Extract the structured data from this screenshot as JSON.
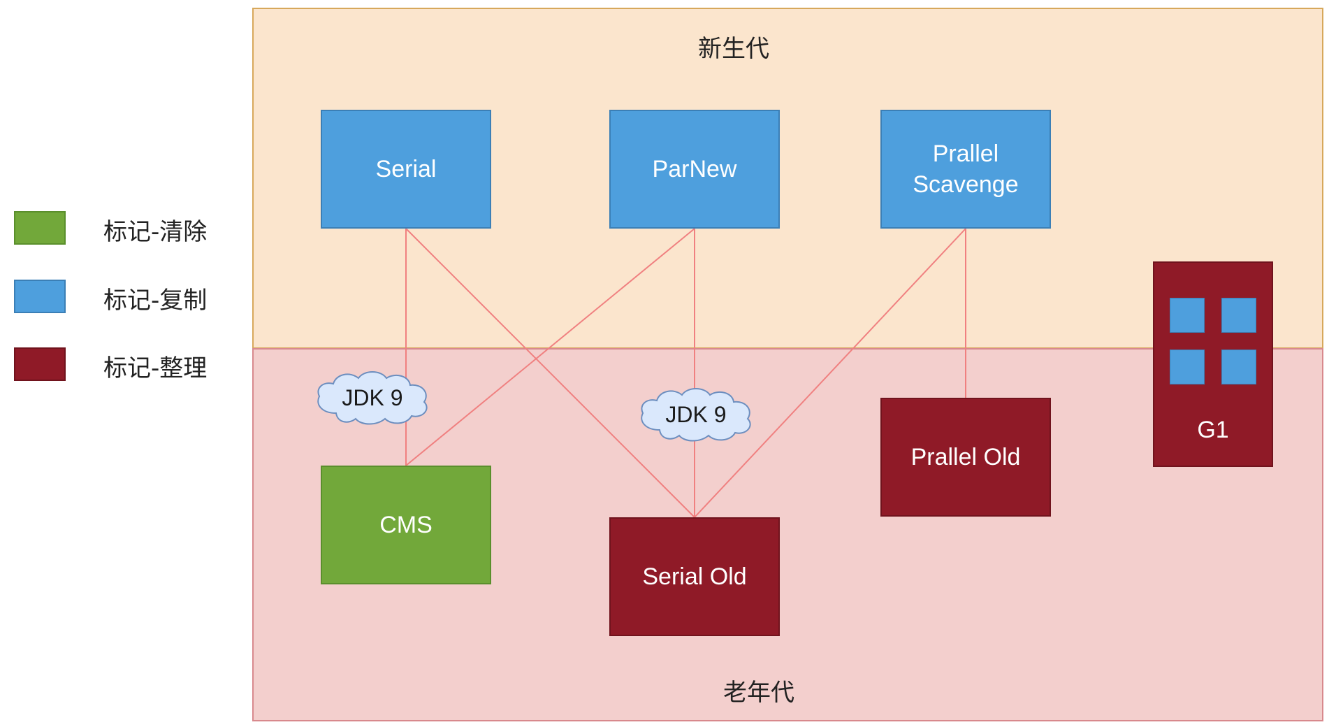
{
  "regions": {
    "young": "新生代",
    "old": "老年代"
  },
  "legend": [
    {
      "label": "标记-清除",
      "color": "#72a83a"
    },
    {
      "label": "标记-复制",
      "color": "#4e9fdd"
    },
    {
      "label": "标记-整理",
      "color": "#8f1a27"
    }
  ],
  "young_collectors": {
    "serial": "Serial",
    "parnew": "ParNew",
    "parallel_scavenge": "Prallel\nScavenge"
  },
  "old_collectors": {
    "cms": "CMS",
    "serial_old": "Serial Old",
    "parallel_old": "Prallel Old"
  },
  "g1": "G1",
  "notes": {
    "jdk9_left": "JDK 9",
    "jdk9_middle": "JDK 9"
  },
  "colors": {
    "young_fill": "#fbe5cd",
    "old_fill": "#f3cfcd",
    "connector": "#f08080",
    "cloud_fill": "#dae8fc"
  }
}
